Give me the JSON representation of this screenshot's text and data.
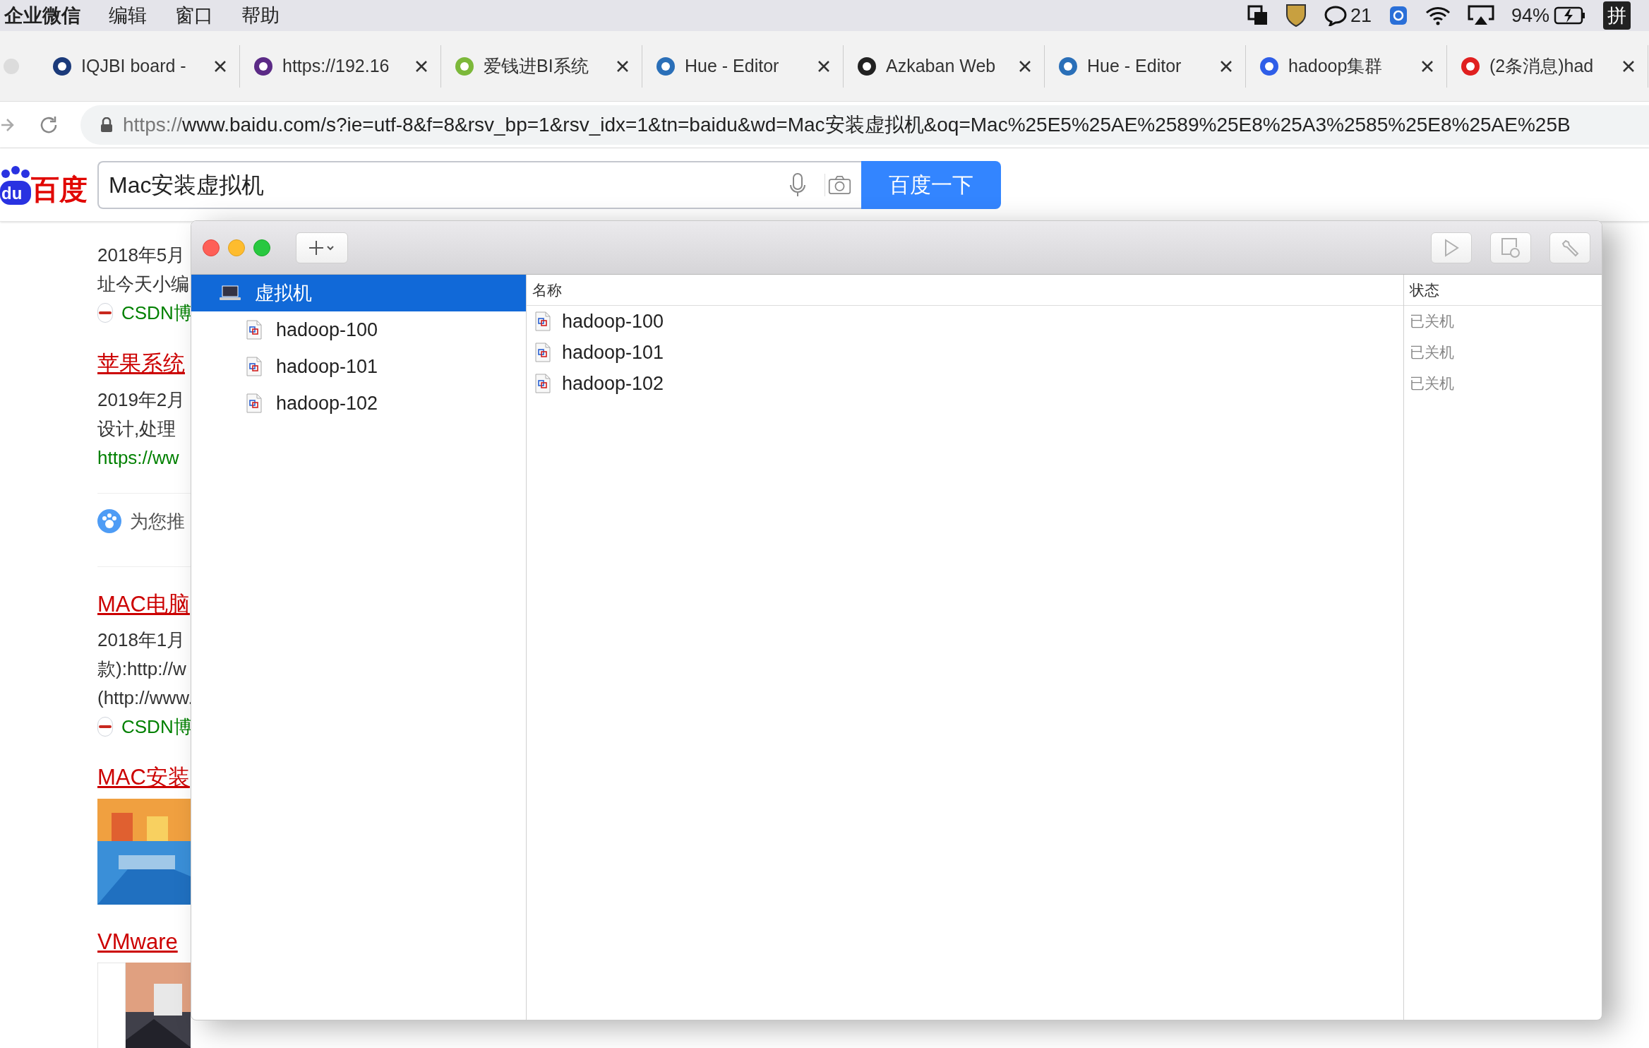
{
  "menu_bar": {
    "app": "企业微信",
    "items": [
      "编辑",
      "窗口",
      "帮助"
    ],
    "chat_count": "21",
    "battery": "94%",
    "input_method": "拼"
  },
  "tabs": [
    {
      "title": "IQJBI board -",
      "color": "#1b3a7a",
      "selected": false
    },
    {
      "title": "https://192.16",
      "color": "#5b2a86",
      "selected": false
    },
    {
      "title": "爱钱进BI系统",
      "color": "#7cb83a",
      "selected": false
    },
    {
      "title": "Hue - Editor",
      "color": "#2a6fb8",
      "selected": false
    },
    {
      "title": "Azkaban Web",
      "color": "#222222",
      "selected": false
    },
    {
      "title": "Hue - Editor",
      "color": "#2a6fb8",
      "selected": false
    },
    {
      "title": "hadoop集群",
      "color": "#2f5ee8",
      "selected": false
    },
    {
      "title": "(2条消息)had",
      "color": "#e02020",
      "selected": false
    }
  ],
  "address_bar": {
    "scheme": "https://",
    "url": "www.baidu.com/s?ie=utf-8&f=8&rsv_bp=1&rsv_idx=1&tn=baidu&wd=Mac安装虚拟机&oq=Mac%25E5%25AE%2589%25E8%25A3%2585%25E8%25AE%25B"
  },
  "search": {
    "logo": "百度",
    "logo_mark": "du",
    "value": "Mac安装虚拟机",
    "button": "百度一下"
  },
  "results": [
    {
      "kind": "snippet",
      "lines": [
        "2018年5月",
        "址今天小编"
      ],
      "source": "CSDN博"
    },
    {
      "kind": "result",
      "title": "苹果系统",
      "lines": [
        "2019年2月",
        "设计,处理"
      ],
      "link": "https://ww"
    },
    {
      "kind": "recommend",
      "text": "为您推"
    },
    {
      "kind": "result",
      "title": "MAC电脑",
      "lines": [
        "2018年1月",
        "款):http://w",
        "(http://www."
      ],
      "source": "CSDN博"
    },
    {
      "title": "MAC安装"
    },
    {
      "title": "VMware"
    }
  ],
  "vm_window": {
    "toolbar": [
      {
        "kind": "add",
        "disabled": false
      },
      {
        "kind": "play",
        "disabled": true
      },
      {
        "kind": "snapshot",
        "disabled": true
      },
      {
        "kind": "settings",
        "disabled": true
      }
    ],
    "sidebar": [
      {
        "label": "虚拟机",
        "selected": true,
        "children": [
          {
            "label": "hadoop-100",
            "selected": false
          },
          {
            "label": "hadoop-101",
            "selected": false
          },
          {
            "label": "hadoop-102",
            "selected": false
          }
        ]
      }
    ],
    "columns": [
      "名称",
      "状态"
    ],
    "rows": [
      {
        "name": "hadoop-100",
        "status": "已关机"
      },
      {
        "name": "hadoop-101",
        "status": "已关机"
      },
      {
        "name": "hadoop-102",
        "status": "已关机"
      }
    ]
  }
}
